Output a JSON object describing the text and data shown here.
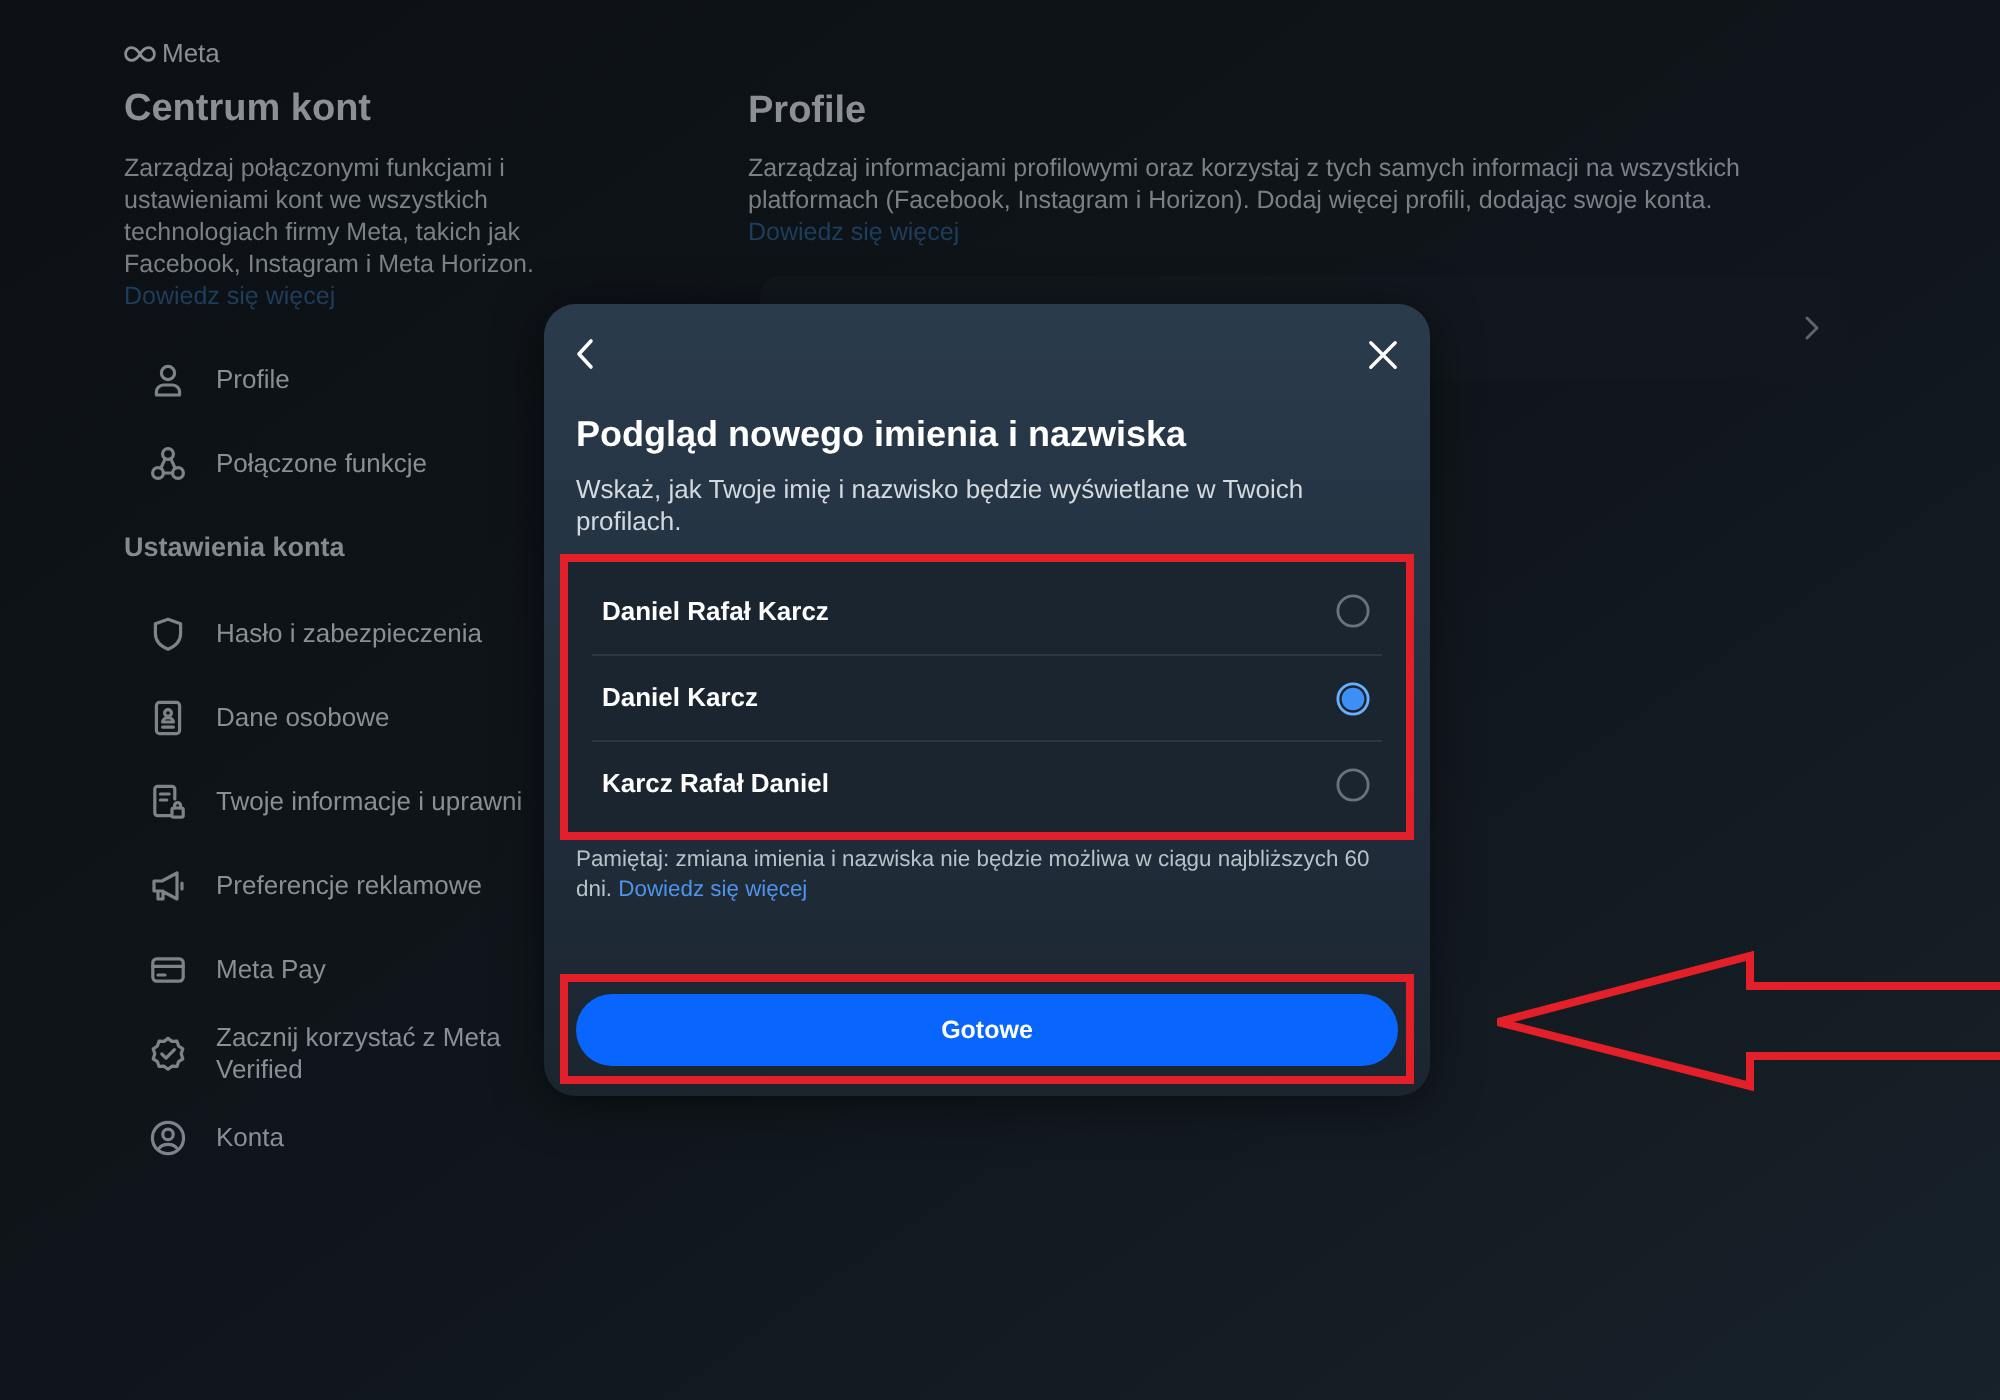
{
  "brand": {
    "name": "Meta"
  },
  "sidebar": {
    "title": "Centrum kont",
    "description": "Zarządzaj połączonymi funkcjami i ustawieniami kont we wszystkich technologiach firmy Meta, takich jak Facebook, Instagram i Meta Horizon.",
    "link": "Dowiedz się więcej",
    "sections": [
      {
        "items": [
          {
            "label": "Profile"
          },
          {
            "label": "Połączone funkcje"
          }
        ]
      },
      {
        "heading": "Ustawienia konta",
        "items": [
          {
            "label": "Hasło i zabezpieczenia"
          },
          {
            "label": "Dane osobowe"
          },
          {
            "label": "Twoje informacje i uprawni"
          },
          {
            "label": "Preferencje reklamowe"
          },
          {
            "label": "Meta Pay"
          },
          {
            "label": "Zacznij korzystać z Meta Verified"
          },
          {
            "label": "Konta"
          }
        ]
      }
    ]
  },
  "main": {
    "title": "Profile",
    "description": "Zarządzaj informacjami profilowymi oraz korzystaj z tych samych informacji na wszystkich platformach (Facebook, Instagram i Horizon). Dodaj więcej profili, dodając swoje konta.",
    "link": "Dowiedz się więcej"
  },
  "dialog": {
    "title": "Podgląd nowego imienia i nazwiska",
    "subtitle": "Wskaż, jak Twoje imię i nazwisko będzie wyświetlane w Twoich profilach.",
    "options": [
      {
        "label": "Daniel Rafał Karcz",
        "selected": false
      },
      {
        "label": "Daniel Karcz",
        "selected": true
      },
      {
        "label": "Karcz Rafał Daniel",
        "selected": false
      }
    ],
    "note": "Pamiętaj: zmiana imienia i nazwiska nie będzie możliwa w ciągu najbliższych 60 dni.",
    "note_link": "Dowiedz się więcej",
    "button": "Gotowe"
  }
}
